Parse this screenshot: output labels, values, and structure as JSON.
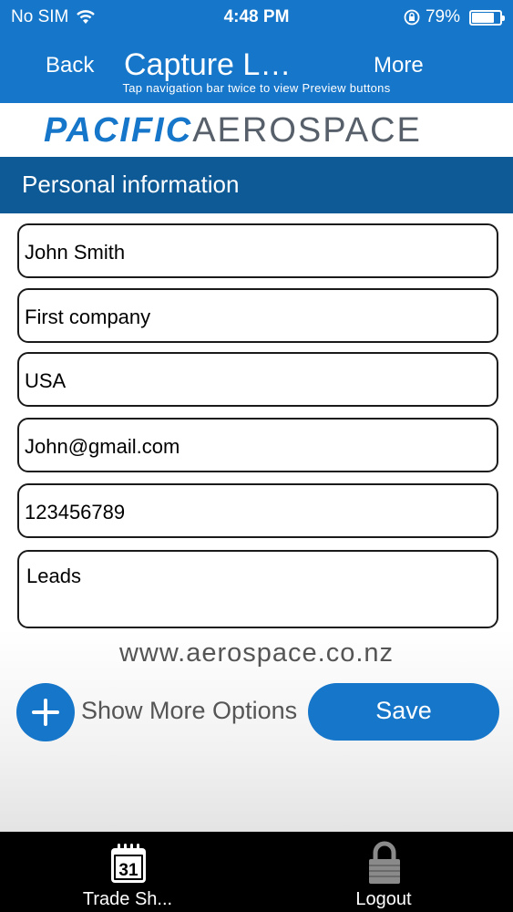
{
  "status_bar": {
    "carrier": "No SIM",
    "time": "4:48 PM",
    "battery": "79%",
    "battery_level": 0.79
  },
  "nav": {
    "back_label": "Back",
    "title": "Capture L…",
    "more_label": "More",
    "hint": "Tap navigation bar twice to view Preview buttons"
  },
  "logo": {
    "part1": "PACIFIC",
    "part2": "AEROSPACE"
  },
  "section_title": "Personal information",
  "form": {
    "name": "John Smith",
    "company": "First company",
    "country": "USA",
    "email": "John@gmail.com",
    "phone": "123456789",
    "notes": "Leads"
  },
  "website": "www.aerospace.co.nz",
  "actions": {
    "show_more_label": "Show More Options",
    "save_label": "Save"
  },
  "tabbar": {
    "calendar_day": "31",
    "trade_label": "Trade Sh...",
    "logout_label": "Logout"
  },
  "colors": {
    "accent": "#1676c9",
    "section": "#0e5a96",
    "tabbar": "#000000"
  }
}
